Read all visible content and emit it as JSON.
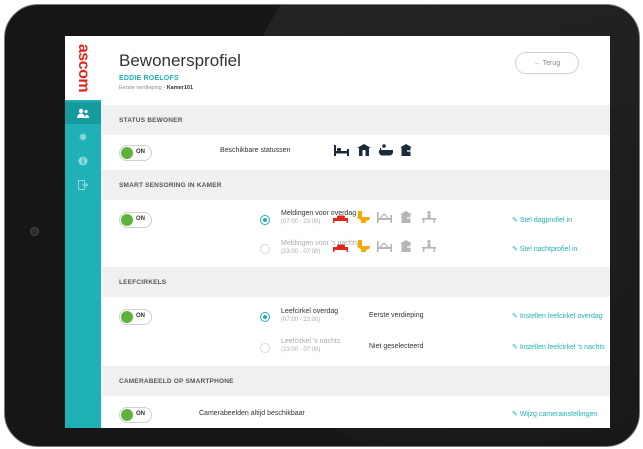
{
  "app": {
    "logo": "ascom"
  },
  "header": {
    "title": "Bewonersprofiel",
    "resident_name": "EDDIE ROELOFS",
    "location_prefix": "Eerste verdieping - ",
    "location_room": "Kamer101",
    "back_label": "← Terug"
  },
  "nav_icons": [
    "user-group-icon",
    "gear-icon",
    "info-icon",
    "logout-icon"
  ],
  "status": {
    "section_title": "STATUS BEWONER",
    "toggle_label": "ON",
    "label": "Beschikbare statussen",
    "icons": [
      "bed-icon",
      "door-icon",
      "bath-icon",
      "out-icon"
    ],
    "icon_color": "#1c2b3c"
  },
  "sensoring": {
    "section_title": "SMART SENSORING IN KAMER",
    "toggle_label": "ON",
    "day_label": "Meldingen voor overdag",
    "day_time": "(07:00 - 23:00)",
    "night_label": "Meldingen voor 's nachtss",
    "night_time": "(23:00 - 07:00)",
    "day_link": "Stel dagprofiel in",
    "night_link": "Stel nachtprofiel in",
    "active_colors": {
      "bed-out": "#e2261c",
      "toilet": "#f5a800"
    },
    "inactive_color": "#b5b5b5"
  },
  "leefcirkels": {
    "section_title": "LEEFCIRKELS",
    "toggle_label": "ON",
    "day_label": "Leefcirkel overdag",
    "day_time": "(07:00 - 23:00)",
    "day_value": "Eerste verdieping",
    "day_link": "Instellen leefcirkel overdag",
    "night_label": "Leefcirkel 's nachts",
    "night_time": "(23:00 - 07:00)",
    "night_value": "Niet geselecteerd",
    "night_link": "Instellen leefcirkel 's nachts"
  },
  "camera": {
    "section_title": "CAMERABEELD OP SMARTPHONE",
    "toggle_label": "ON",
    "label": "Camerabeelden altijd beschikbaar",
    "link": "Wijzg camerainstellingen"
  },
  "colors": {
    "accent": "#1fb1b5",
    "toggle_on": "#5fb23a",
    "brand": "#e2261c"
  }
}
